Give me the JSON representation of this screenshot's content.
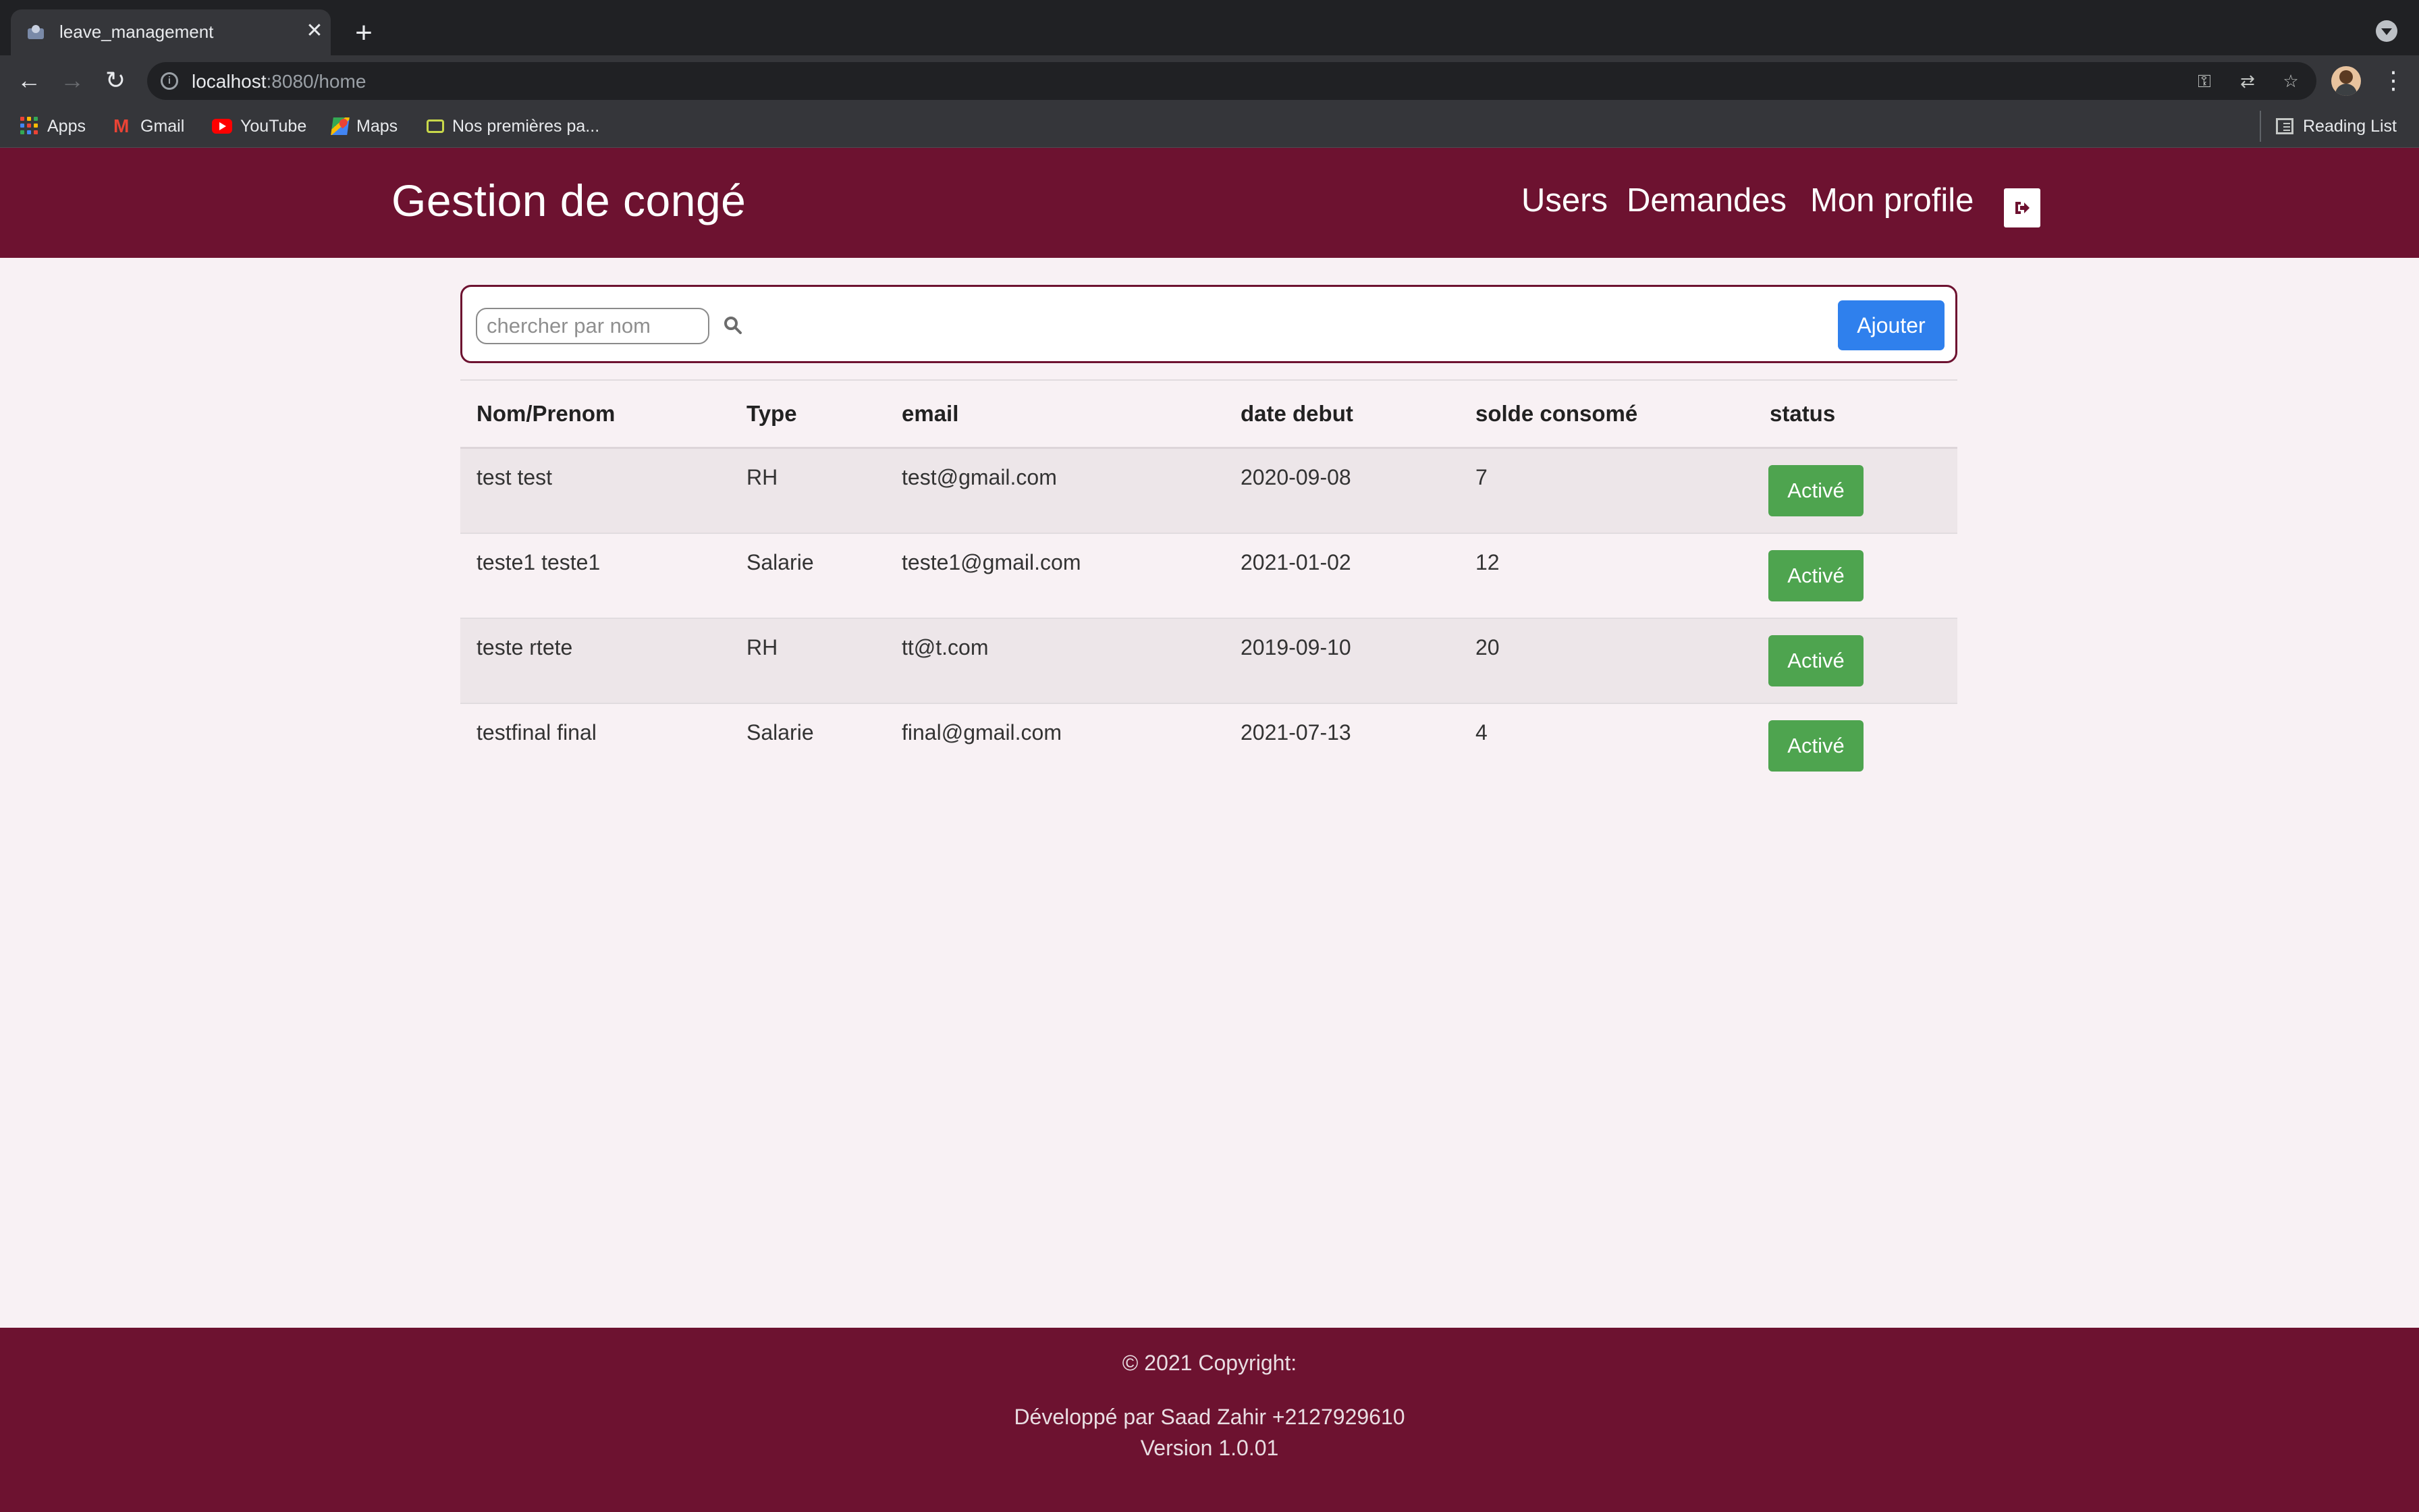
{
  "browser": {
    "tab_title": "leave_management",
    "url_host": "localhost",
    "url_rest": ":8080/home",
    "bookmarks": [
      {
        "label": "Apps",
        "icon": "apps-grid-icon"
      },
      {
        "label": "Gmail",
        "icon": "gmail-icon"
      },
      {
        "label": "YouTube",
        "icon": "youtube-icon"
      },
      {
        "label": "Maps",
        "icon": "maps-icon"
      },
      {
        "label": "Nos premières pa...",
        "icon": "bookmark-folder-icon"
      }
    ],
    "reading_list": "Reading List"
  },
  "navbar": {
    "brand": "Gestion de congé",
    "links": [
      "Users",
      "Demandes",
      "Mon profile"
    ],
    "logout_icon": "sign-out-icon"
  },
  "search": {
    "placeholder": "chercher par nom",
    "add_label": "Ajouter"
  },
  "table": {
    "headers": [
      "Nom/Prenom",
      "Type",
      "email",
      "date debut",
      "solde consomé",
      "status"
    ],
    "rows": [
      {
        "name": "test test",
        "type": "RH",
        "email": "test@gmail.com",
        "date": "2020-09-08",
        "solde": "7",
        "status": "Activé"
      },
      {
        "name": "teste1 teste1",
        "type": "Salarie",
        "email": "teste1@gmail.com",
        "date": "2021-01-02",
        "solde": "12",
        "status": "Activé"
      },
      {
        "name": "teste rtete",
        "type": "RH",
        "email": "tt@t.com",
        "date": "2019-09-10",
        "solde": "20",
        "status": "Activé"
      },
      {
        "name": "testfinal final",
        "type": "Salarie",
        "email": "final@gmail.com",
        "date": "2021-07-13",
        "solde": "4",
        "status": "Activé"
      }
    ]
  },
  "footer": {
    "copyright": "© 2021 Copyright:",
    "developer": "Développé par Saad Zahir +2127929610",
    "version": "Version 1.0.01"
  },
  "colors": {
    "brand": "#6d1230",
    "primary_button": "#2f80ed",
    "status_active": "#4ea44f",
    "page_background": "#f8f1f4"
  }
}
